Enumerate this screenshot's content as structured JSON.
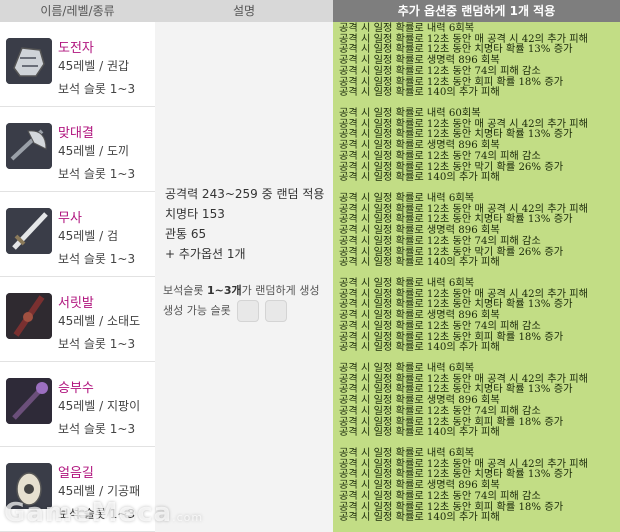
{
  "header": {
    "col1": "이름/레벨/종류",
    "col2": "설명",
    "col3": "추가 옵션중 랜덤하게 1개 적용"
  },
  "items": [
    {
      "name": "도전자",
      "level_type": "45레벨 / 권갑",
      "slots": "보석 슬롯 1~3",
      "icon": "gauntlet-icon"
    },
    {
      "name": "맞대결",
      "level_type": "45레벨 / 도끼",
      "slots": "보석 슬롯 1~3",
      "icon": "axe-icon"
    },
    {
      "name": "무사",
      "level_type": "45레벨 / 검",
      "slots": "보석 슬롯 1~3",
      "icon": "sword-icon"
    },
    {
      "name": "서릿발",
      "level_type": "45레벨 / 소태도",
      "slots": "보석 슬롯 1~3",
      "icon": "dagger-icon"
    },
    {
      "name": "승부수",
      "level_type": "45레벨 / 지팡이",
      "slots": "보석 슬롯 1~3",
      "icon": "staff-icon"
    },
    {
      "name": "얼음길",
      "level_type": "45레벨 / 기공패",
      "slots": "보석 슬롯 1~3",
      "icon": "talisman-icon"
    }
  ],
  "description": {
    "attack": "공격력 243~259 중 랜덤 적용",
    "crit": "치명타 153",
    "pierce": "관통 65",
    "extra": "+ 추가옵션 1개",
    "gem_prefix": "보석슬롯 ",
    "gem_bold": "1~3개",
    "gem_suffix": "가 랜덤하게 생성",
    "gem_possible": "생성 가능 슬롯"
  },
  "options": [
    [
      "공격 시 일정 확률로 내력 6회복",
      "공격 시 일정 확률로 12초 동안 매 공격 시 42의 추가 피해",
      "공격 시 일정 확률로 12초 동안 치명타 확률 13% 증가",
      "공격 시 일정 확률로 생명력 896 회복",
      "공격 시 일정 확률로 12초 동안 74의 피해 감소",
      "공격 시 일정 확률로 12초 동안 회피 확률 18% 증가",
      "공격 시 일정 확률로 140의 추가 피해"
    ],
    [
      "공격 시 일정 확률로 내력 60회복",
      "공격 시 일정 확률로 12초 동안 매 공격 시 42의 추가 피해",
      "공격 시 일정 확률로 12초 동안 치명타 확률 13% 증가",
      "공격 시 일정 확률로 생명력 896 회복",
      "공격 시 일정 확률로 12초 동안 74의 피해 감소",
      "공격 시 일정 확률로 12초 동안 막기 확률 26% 증가",
      "공격 시 일정 확률로 140의 추가 피해"
    ],
    [
      "공격 시 일정 확률로 내력 6회복",
      "공격 시 일정 확률로 12초 동안 매 공격 시 42의 추가 피해",
      "공격 시 일정 확률로 12초 동안 치명타 확률 13% 증가",
      "공격 시 일정 확률로 생명력 896 회복",
      "공격 시 일정 확률로 12초 동안 74의 피해 감소",
      "공격 시 일정 확률로 12초 동안 막기 확률 26% 증가",
      "공격 시 일정 확률로 140의 추가 피해"
    ],
    [
      "공격 시 일정 확률로 내력 6회복",
      "공격 시 일정 확률로 12초 동안 매 공격 시 42의 추가 피해",
      "공격 시 일정 확률로 12초 동안 치명타 확률 13% 증가",
      "공격 시 일정 확률로 생명력 896 회복",
      "공격 시 일정 확률로 12초 동안 74의 피해 감소",
      "공격 시 일정 확률로 12초 동안 회피 확률 18% 증가",
      "공격 시 일정 확률로 140의 추가 피해"
    ],
    [
      "공격 시 일정 확률로 내력 6회복",
      "공격 시 일정 확률로 12초 동안 매 공격 시 42의 추가 피해",
      "공격 시 일정 확률로 12초 동안 치명타 확률 13% 증가",
      "공격 시 일정 확률로 생명력 896 회복",
      "공격 시 일정 확률로 12초 동안 74의 피해 감소",
      "공격 시 일정 확률로 12초 동안 회피 확률 18% 증가",
      "공격 시 일정 확률로 140의 추가 피해"
    ],
    [
      "공격 시 일정 확률로 내력 6회복",
      "공격 시 일정 확률로 12초 동안 매 공격 시 42의 추가 피해",
      "공격 시 일정 확률로 12초 동안 치명타 확률 13% 증가",
      "공격 시 일정 확률로 생명력 896 회복",
      "공격 시 일정 확률로 12초 동안 74의 피해 감소",
      "공격 시 일정 확률로 12초 동안 회피 확률 18% 증가",
      "공격 시 일정 확률로 140의 추가 피해"
    ]
  ],
  "watermark": {
    "brand": "GameMeca",
    "domain": ".com"
  },
  "colors": {
    "name": "#b0147e",
    "options_bg": "#c2dd85",
    "header_dark": "#7e7e7e",
    "header_light": "#d8d8d8",
    "desc_bg": "#f3f3f3"
  }
}
